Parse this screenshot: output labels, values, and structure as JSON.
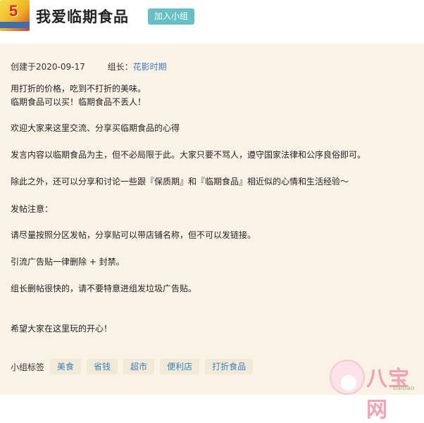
{
  "header": {
    "group_title": "我爱临期食品",
    "join_label": "加入小组"
  },
  "meta": {
    "created": "创建于2020-09-17",
    "leader_label": "组长：",
    "leader_name": "花影时期"
  },
  "description": [
    "用打折的价格，吃到不打折的美味。",
    "临期食品可以买！临期食品不丢人！",
    "欢迎大家来这里交流、分享买临期食品的心得",
    "发言内容以临期食品为主，但不必局限于此。大家只要不骂人，遵守国家法律和公序良俗即可。",
    "除此之外，还可以分享和讨论一些跟『保质期』和『临期食品』相近似的心情和生活经验～",
    "发帖注意：",
    "请尽量按照分区发帖，分享贴可以带店铺名称，但不可以发链接。",
    "引流广告贴一律删除 + 封禁。",
    "组长删帖很快的，请不要特意进组发垃圾广告贴。",
    "希望大家在这里玩的开心！"
  ],
  "tags": {
    "label": "小组标签",
    "items": [
      "美食",
      "省钱",
      "超市",
      "便利店",
      "打折食品"
    ]
  },
  "watermark": {
    "text": "八宝网",
    "sub": "baibao"
  }
}
